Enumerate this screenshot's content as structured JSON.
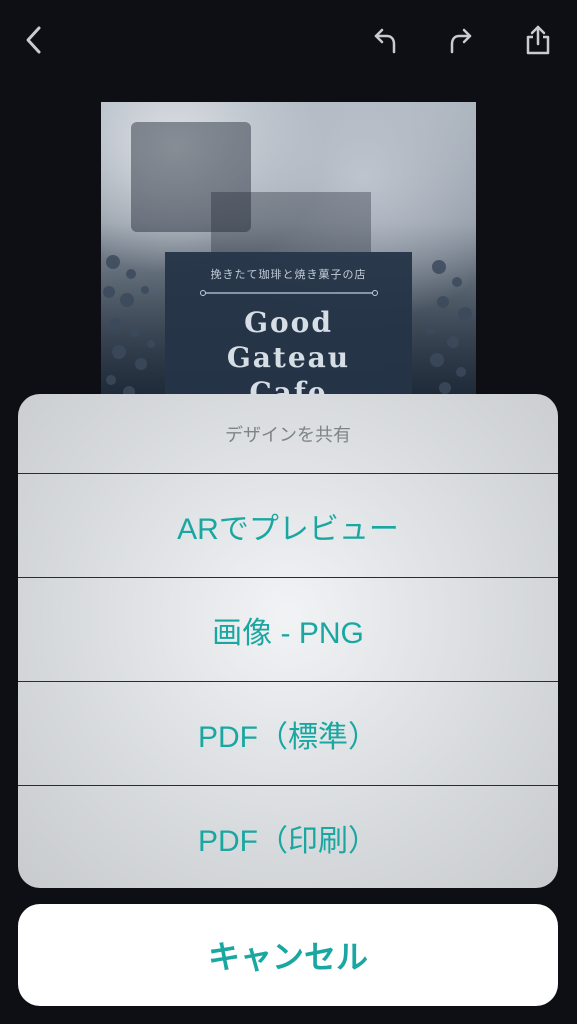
{
  "toolbar": {
    "back_icon": "chevron-left-icon",
    "undo_icon": "undo-icon",
    "redo_icon": "redo-icon",
    "share_icon": "share-icon"
  },
  "design": {
    "tagline": "挽きたて珈琲と焼き菓子の店",
    "title_line1": "Good",
    "title_line2": "Gateau",
    "title_line3": "Cafe",
    "panel_color": "#253447"
  },
  "share_sheet": {
    "header": "デザインを共有",
    "options": [
      {
        "label": "ARでプレビュー"
      },
      {
        "label": "画像 - PNG"
      },
      {
        "label": "PDF（標準）"
      },
      {
        "label": "PDF（印刷）"
      }
    ],
    "cancel_label": "キャンセル",
    "accent_color": "#1aa7a1"
  }
}
